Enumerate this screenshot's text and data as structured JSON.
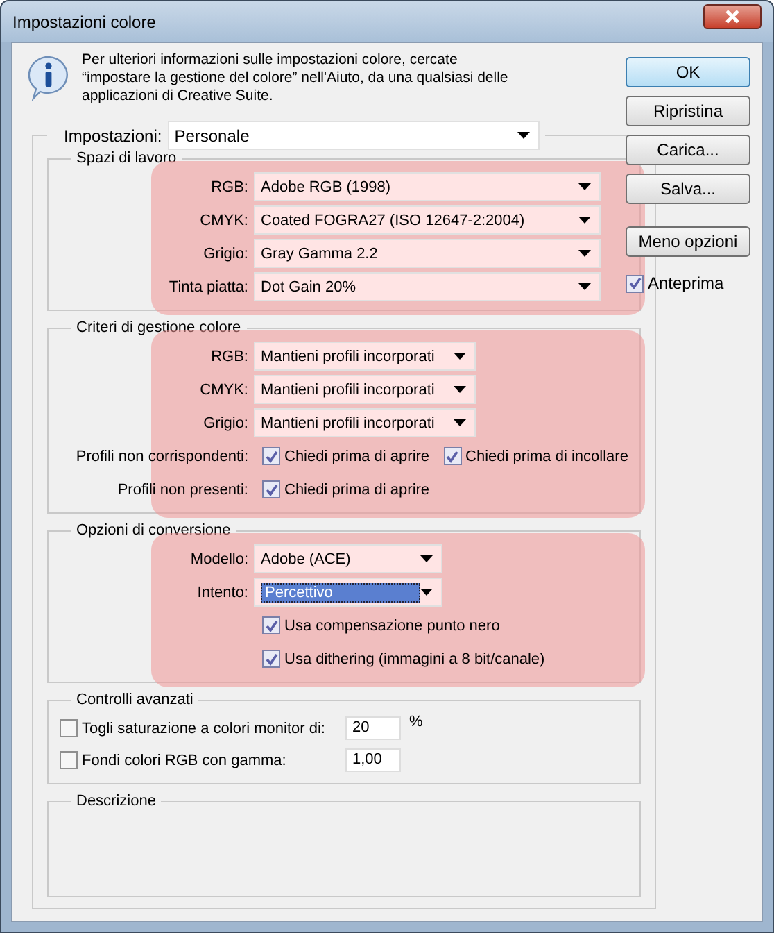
{
  "window": {
    "title": "Impostazioni colore"
  },
  "info": "Per ulteriori informazioni sulle impostazioni colore, cercate “impostare la gestione del colore” nell'Aiuto, da una qualsiasi delle applicazioni di Creative Suite.",
  "settings": {
    "label": "Impostazioni:",
    "value": "Personale"
  },
  "sections": [
    {
      "title": "Spazi di lavoro",
      "highlighted": true,
      "rows": [
        {
          "kind": "select",
          "label": "RGB:",
          "value": "Adobe RGB (1998)",
          "focused": false
        },
        {
          "kind": "select",
          "label": "CMYK:",
          "value": "Coated FOGRA27 (ISO 12647-2:2004)",
          "focused": false
        },
        {
          "kind": "select",
          "label": "Grigio:",
          "value": "Gray Gamma 2.2",
          "focused": false
        },
        {
          "kind": "select",
          "label": "Tinta piatta:",
          "value": "Dot Gain 20%",
          "focused": false
        }
      ]
    },
    {
      "title": "Criteri di gestione colore",
      "highlighted": true,
      "rows": [
        {
          "kind": "select",
          "label": "RGB:",
          "value": "Mantieni profili incorporati",
          "focused": false
        },
        {
          "kind": "select",
          "label": "CMYK:",
          "value": "Mantieni profili incorporati",
          "focused": false
        },
        {
          "kind": "select",
          "label": "Grigio:",
          "value": "Mantieni profili incorporati",
          "focused": false
        },
        {
          "kind": "checks",
          "label": "Profili non corrispondenti:",
          "checks": [
            {
              "label": "Chiedi prima di aprire",
              "checked": true
            },
            {
              "label": "Chiedi prima di incollare",
              "checked": true
            }
          ]
        },
        {
          "kind": "checks",
          "label": "Profili non presenti:",
          "checks": [
            {
              "label": "Chiedi prima di aprire",
              "checked": true
            }
          ]
        }
      ]
    },
    {
      "title": "Opzioni di conversione",
      "highlighted": true,
      "rows": [
        {
          "kind": "select",
          "label": "Modello:",
          "value": "Adobe (ACE)",
          "focused": false
        },
        {
          "kind": "select",
          "label": "Intento:",
          "value": "Percettivo",
          "focused": true
        },
        {
          "kind": "checks",
          "checks": [
            {
              "label": "Usa compensazione punto nero",
              "checked": true
            }
          ]
        },
        {
          "kind": "checks",
          "checks": [
            {
              "label": "Usa dithering (immagini a 8 bit/canale)",
              "checked": true
            }
          ]
        }
      ]
    },
    {
      "title": "Controlli avanzati",
      "highlighted": false,
      "rows": [
        {
          "kind": "input",
          "label": "Togli saturazione a colori monitor di:",
          "checked": false,
          "value": "20",
          "unit": "%"
        },
        {
          "kind": "input",
          "label": "Fondi colori RGB con gamma:",
          "checked": false,
          "value": "1,00"
        }
      ]
    }
  ],
  "description": {
    "title": "Descrizione"
  },
  "buttons": [
    {
      "label": "OK",
      "default": true
    },
    {
      "label": "Ripristina",
      "default": false
    },
    {
      "label": "Carica...",
      "default": false
    },
    {
      "label": "Salva...",
      "default": false
    },
    {
      "label": "Meno opzioni",
      "default": false
    }
  ],
  "preview": {
    "label": "Anteprima",
    "checked": true
  }
}
